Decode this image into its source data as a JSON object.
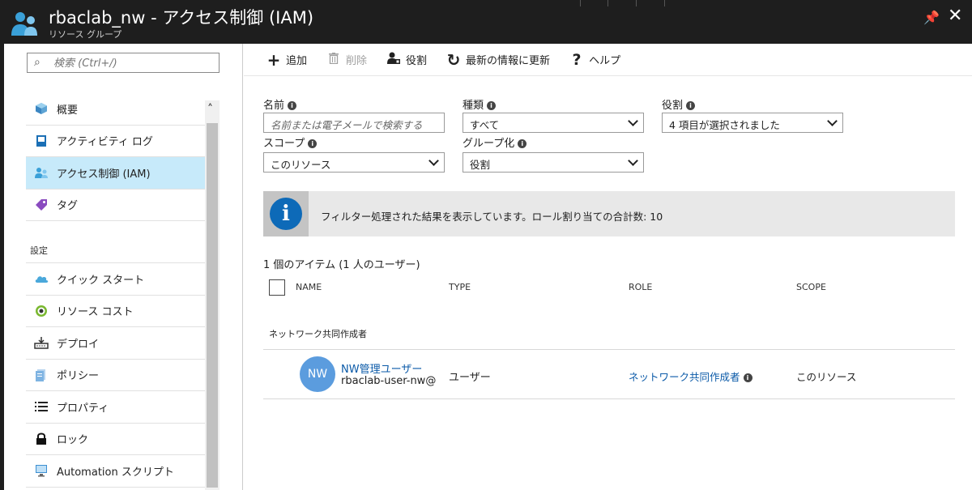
{
  "header": {
    "title": "rbaclab_nw - アクセス制御 (IAM)",
    "subtitle": "リソース グループ"
  },
  "search": {
    "placeholder": "検索 (Ctrl+/)"
  },
  "nav": {
    "items": [
      {
        "label": "概要",
        "icon": "cube-icon"
      },
      {
        "label": "アクティビティ ログ",
        "icon": "activity-log-icon"
      },
      {
        "label": "アクセス制御 (IAM)",
        "icon": "iam-users-icon",
        "selected": true
      },
      {
        "label": "タグ",
        "icon": "tag-icon"
      }
    ],
    "section_settings": "設定",
    "settings_items": [
      {
        "label": "クイック スタート",
        "icon": "cloud-icon"
      },
      {
        "label": "リソース コスト",
        "icon": "cost-icon"
      },
      {
        "label": "デプロイ",
        "icon": "deploy-icon"
      },
      {
        "label": "ポリシー",
        "icon": "policy-icon"
      },
      {
        "label": "プロパティ",
        "icon": "properties-icon"
      },
      {
        "label": "ロック",
        "icon": "lock-icon"
      },
      {
        "label": "Automation スクリプト",
        "icon": "automation-icon"
      }
    ]
  },
  "toolbar": {
    "add": "追加",
    "delete": "削除",
    "roles": "役割",
    "refresh": "最新の情報に更新",
    "help": "ヘルプ"
  },
  "filters": {
    "name_label": "名前",
    "name_placeholder": "名前または電子メールで検索する",
    "type_label": "種類",
    "type_value": "すべて",
    "role_label": "役割",
    "role_value": "4 項目が選択されました",
    "scope_label": "スコープ",
    "scope_value": "このリソース",
    "group_label": "グループ化",
    "group_value": "役割"
  },
  "banner": {
    "message": "フィルター処理された結果を表示しています。ロール割り当ての合計数: 10"
  },
  "table": {
    "count": "1 個のアイテム (1 人のユーザー)",
    "headers": {
      "name": "NAME",
      "type": "TYPE",
      "role": "ROLE",
      "scope": "SCOPE"
    },
    "group": "ネットワーク共同作成者",
    "rows": [
      {
        "avatar": "NW",
        "name": "NW管理ユーザー",
        "id": "rbaclab-user-nw@",
        "type": "ユーザー",
        "role": "ネットワーク共同作成者",
        "scope": "このリソース"
      }
    ]
  },
  "colors": {
    "header_bg": "#1e1e1e",
    "selected_nav": "#c7eafa",
    "link": "#0b5aa8",
    "info_blue": "#0d6ab8",
    "avatar": "#5b9cde"
  }
}
